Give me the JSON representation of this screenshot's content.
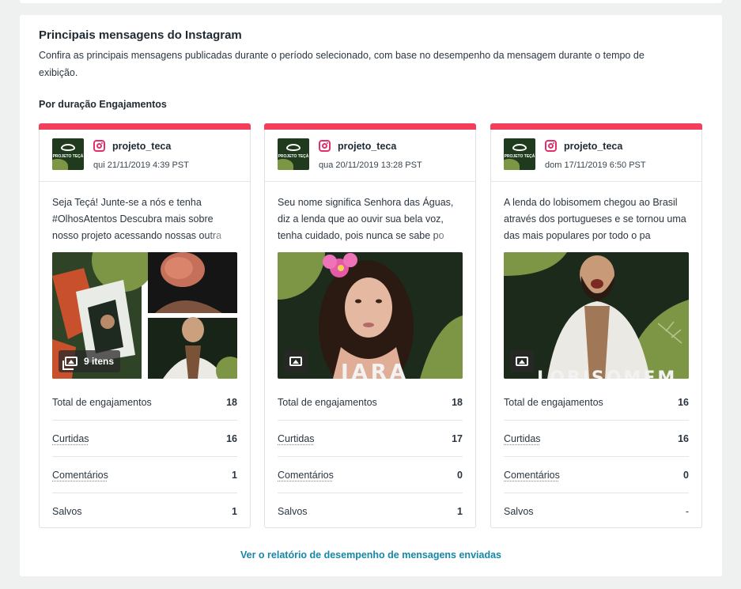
{
  "panel": {
    "title": "Principais mensagens do Instagram",
    "description": "Confira as principais mensagens publicadas durante o período selecionado, com base no desempenho da mensagem durante o tempo de exibição.",
    "section_label": "Por duração Engajamentos"
  },
  "colors": {
    "accent_bar": "#f23f5e",
    "instagram": "#e1306c",
    "link": "#1587a8"
  },
  "cards": [
    {
      "profile": "projeto_teca",
      "date": "qui 21/11/2019 4:39 PST",
      "text": "Seja Teçá! Junte-se a nós e tenha #OlhosAtentos Descubra mais sobre nosso projeto acessando nossas outra",
      "media_type": "carousel",
      "media_badge_icon": "gallery-icon",
      "media_badge_label": "9 itens",
      "stats": [
        {
          "label": "Total de engajamentos",
          "value": "18"
        },
        {
          "label": "Curtidas",
          "value": "16"
        },
        {
          "label": "Comentários",
          "value": "1"
        },
        {
          "label": "Salvos",
          "value": "1"
        }
      ]
    },
    {
      "profile": "projeto_teca",
      "date": "qua 20/11/2019 13:28 PST",
      "text": "Seu nome significa Senhora das Águas, diz a lenda que ao ouvir sua bela voz, tenha cuidado, pois nunca se sabe po",
      "media_type": "image",
      "media_badge_icon": "image-icon",
      "media_caption": "IARA",
      "stats": [
        {
          "label": "Total de engajamentos",
          "value": "18"
        },
        {
          "label": "Curtidas",
          "value": "17"
        },
        {
          "label": "Comentários",
          "value": "0"
        },
        {
          "label": "Salvos",
          "value": "1"
        }
      ]
    },
    {
      "profile": "projeto_teca",
      "date": "dom 17/11/2019 6:50 PST",
      "text": "A lenda do lobisomem chegou ao Brasil através dos portugueses e se tornou uma das mais populares por todo o pa",
      "media_type": "image",
      "media_badge_icon": "image-icon",
      "media_caption": "LOBISOMEM",
      "stats": [
        {
          "label": "Total de engajamentos",
          "value": "16"
        },
        {
          "label": "Curtidas",
          "value": "16"
        },
        {
          "label": "Comentários",
          "value": "0"
        },
        {
          "label": "Salvos",
          "value": "-"
        }
      ]
    }
  ],
  "avatar_text": "PROJETO TEÇÁ",
  "footer": {
    "link_label": "Ver o relatório de desempenho de mensagens enviadas"
  }
}
